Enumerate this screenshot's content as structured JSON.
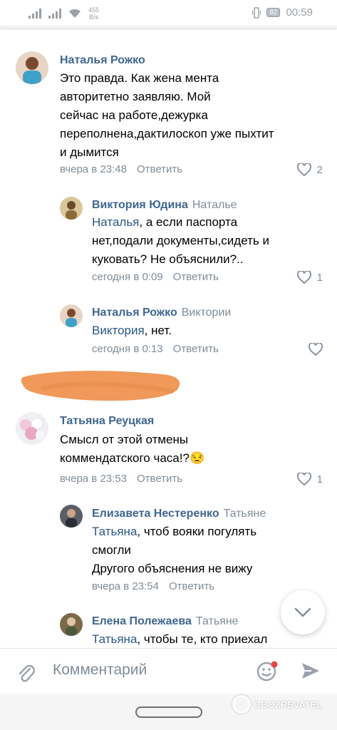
{
  "statusbar": {
    "net_speed_value": "455",
    "net_speed_unit": "B/s",
    "battery": "82",
    "time": "00:59"
  },
  "comments": [
    {
      "author": "Наталья Рожко",
      "lines": [
        "Это правда. Как жена мента",
        "авторитетно заявляю. Мой",
        "сейчас на работе,дежурка",
        "переполнена,дактилоскоп уже пыхтит",
        "и дымится"
      ],
      "time": "вчера в 23:48",
      "reply_label": "Ответить",
      "likes": "2"
    },
    {
      "author": "Виктория Юдина",
      "reply_to": "Наталье",
      "mention": "Наталья",
      "lines": [
        ", а если паспорта",
        "нет,подали документы,сидеть и",
        "куковать? Не объяснили?.."
      ],
      "time": "сегодня в 0:09",
      "reply_label": "Ответить",
      "likes": "1"
    },
    {
      "author": "Наталья Рожко",
      "reply_to": "Виктории",
      "mention": "Виктория",
      "lines": [
        ", нет."
      ],
      "time": "сегодня в 0:13",
      "reply_label": "Ответить",
      "likes": ""
    },
    {
      "author": "Татьяна Реуцкая",
      "lines": [
        "Смысл от этой отмены",
        "коммендатского часа!?"
      ],
      "emoji": "😒",
      "time": "вчера в 23:53",
      "reply_label": "Ответить",
      "likes": "1"
    },
    {
      "author": "Елизавета Нестеренко",
      "reply_to": "Татьяне",
      "mention": "Татьяна",
      "lines": [
        ", чтоб вояки погулять",
        "смогли",
        "Другого объяснения не вижу"
      ],
      "time": "вчера в 23:54",
      "reply_label": "Ответить",
      "likes": ""
    },
    {
      "author": "Елена Полежаева",
      "reply_to": "Татьяне",
      "mention": "Татьяна",
      "lines": [
        ", чтобы те, кто приехал"
      ]
    }
  ],
  "composer": {
    "placeholder": "Комментарий"
  },
  "watermark": "OBOZREVATEL",
  "colors": {
    "author": "#3f6690",
    "mention": "#2a5885",
    "meta": "#818c99",
    "smear": "#f0995a"
  }
}
